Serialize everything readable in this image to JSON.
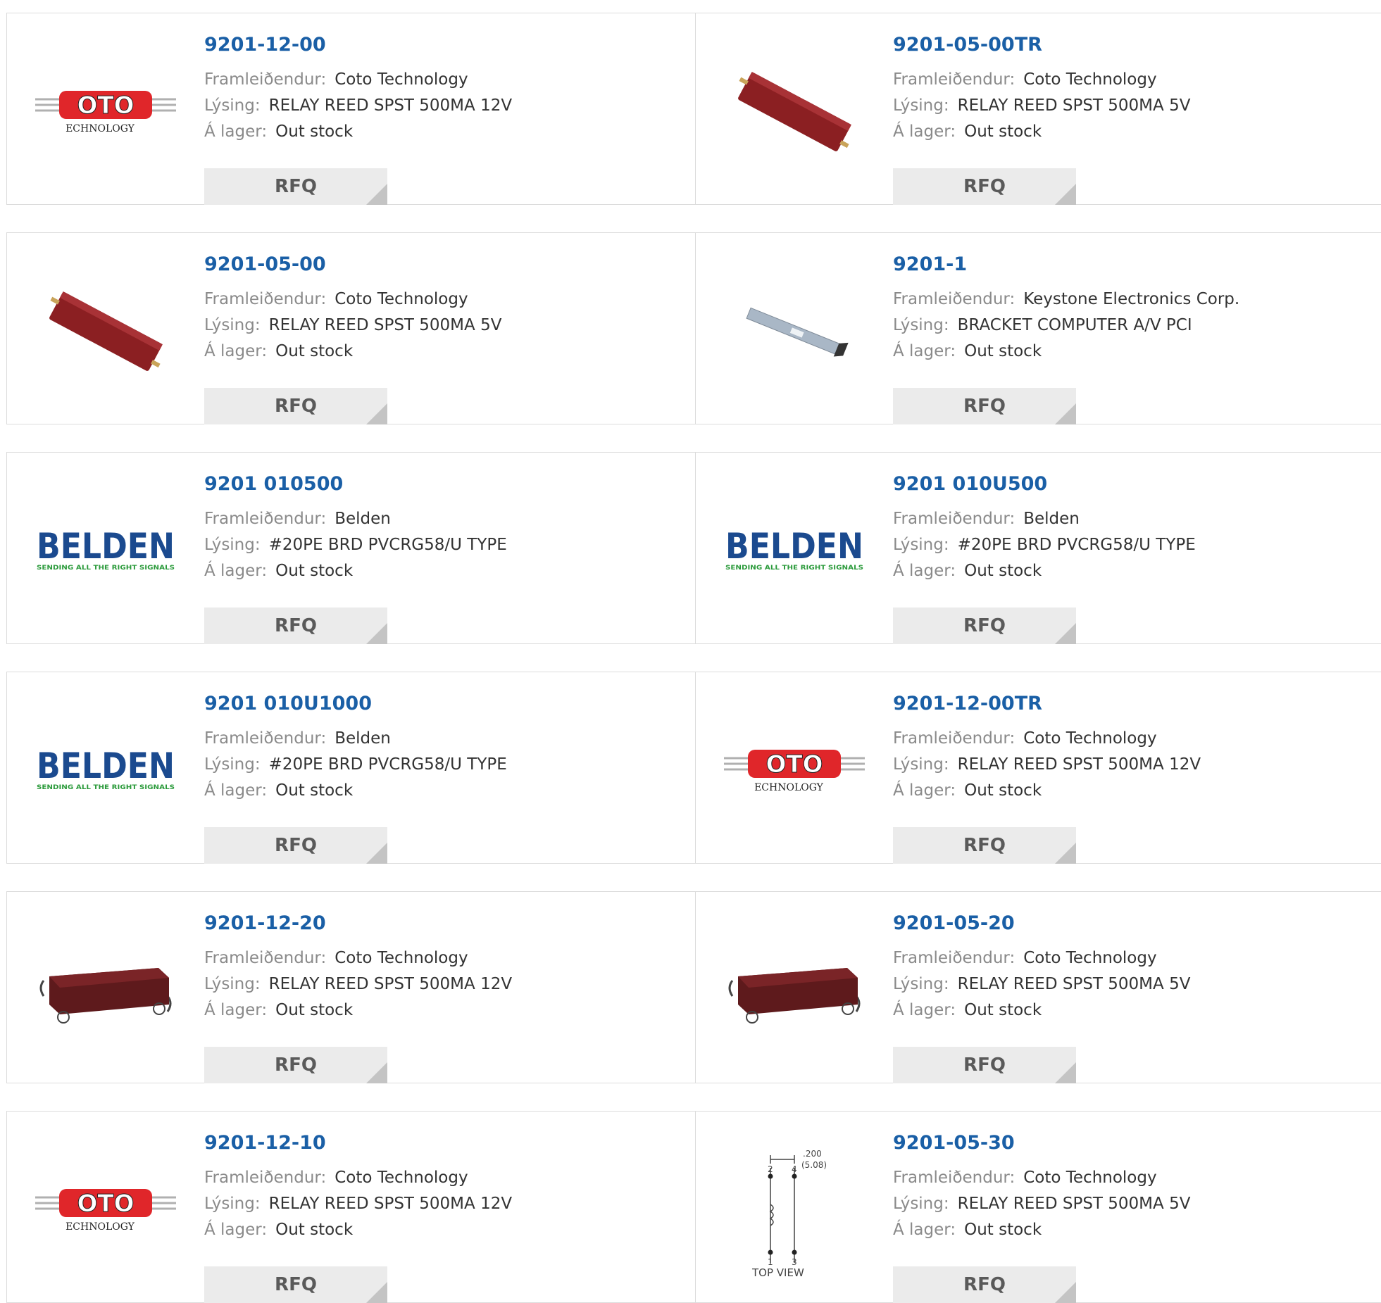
{
  "labels": {
    "manufacturer": "Framleiðendur:",
    "description": "Lýsing:",
    "stock": "Á lager:",
    "rfq": "RFQ"
  },
  "logo_text": {
    "belden": "BELDEN",
    "belden_tagline": "SENDING ALL THE RIGHT SIGNALS",
    "coto": "OTO",
    "coto_sub": "ECHNOLOGY",
    "diagram_dim": ".200",
    "diagram_dim_mm": "(5.08)",
    "diagram_caption": "TOP VIEW"
  },
  "colors": {
    "link": "#1a5fa6",
    "coto_red": "#e0262a",
    "belden_blue": "#1b4a8f",
    "belden_green": "#2a9a3a",
    "relay": "#8b1f22"
  },
  "products": [
    {
      "part": "9201-12-00",
      "manufacturer": "Coto Technology",
      "description": "RELAY REED SPST 500MA 12V",
      "stock": "Out stock",
      "image": "coto-logo"
    },
    {
      "part": "9201-05-00TR",
      "manufacturer": "Coto Technology",
      "description": "RELAY REED SPST 500MA 5V",
      "stock": "Out stock",
      "image": "relay-smd"
    },
    {
      "part": "9201-05-00",
      "manufacturer": "Coto Technology",
      "description": "RELAY REED SPST 500MA 5V",
      "stock": "Out stock",
      "image": "relay-smd"
    },
    {
      "part": "9201-1",
      "manufacturer": "Keystone Electronics Corp.",
      "description": "BRACKET COMPUTER A/V PCI",
      "stock": "Out stock",
      "image": "bracket"
    },
    {
      "part": "9201 010500",
      "manufacturer": "Belden",
      "description": "#20PE BRD PVCRG58/U TYPE",
      "stock": "Out stock",
      "image": "belden-logo"
    },
    {
      "part": "9201 010U500",
      "manufacturer": "Belden",
      "description": "#20PE BRD PVCRG58/U TYPE",
      "stock": "Out stock",
      "image": "belden-logo"
    },
    {
      "part": "9201 010U1000",
      "manufacturer": "Belden",
      "description": "#20PE BRD PVCRG58/U TYPE",
      "stock": "Out stock",
      "image": "belden-logo"
    },
    {
      "part": "9201-12-00TR",
      "manufacturer": "Coto Technology",
      "description": "RELAY REED SPST 500MA 12V",
      "stock": "Out stock",
      "image": "coto-logo"
    },
    {
      "part": "9201-12-20",
      "manufacturer": "Coto Technology",
      "description": "RELAY REED SPST 500MA 12V",
      "stock": "Out stock",
      "image": "relay-dip"
    },
    {
      "part": "9201-05-20",
      "manufacturer": "Coto Technology",
      "description": "RELAY REED SPST 500MA 5V",
      "stock": "Out stock",
      "image": "relay-dip"
    },
    {
      "part": "9201-12-10",
      "manufacturer": "Coto Technology",
      "description": "RELAY REED SPST 500MA 12V",
      "stock": "Out stock",
      "image": "coto-logo"
    },
    {
      "part": "9201-05-30",
      "manufacturer": "Coto Technology",
      "description": "RELAY REED SPST 500MA 5V",
      "stock": "Out stock",
      "image": "relay-diagram"
    }
  ]
}
